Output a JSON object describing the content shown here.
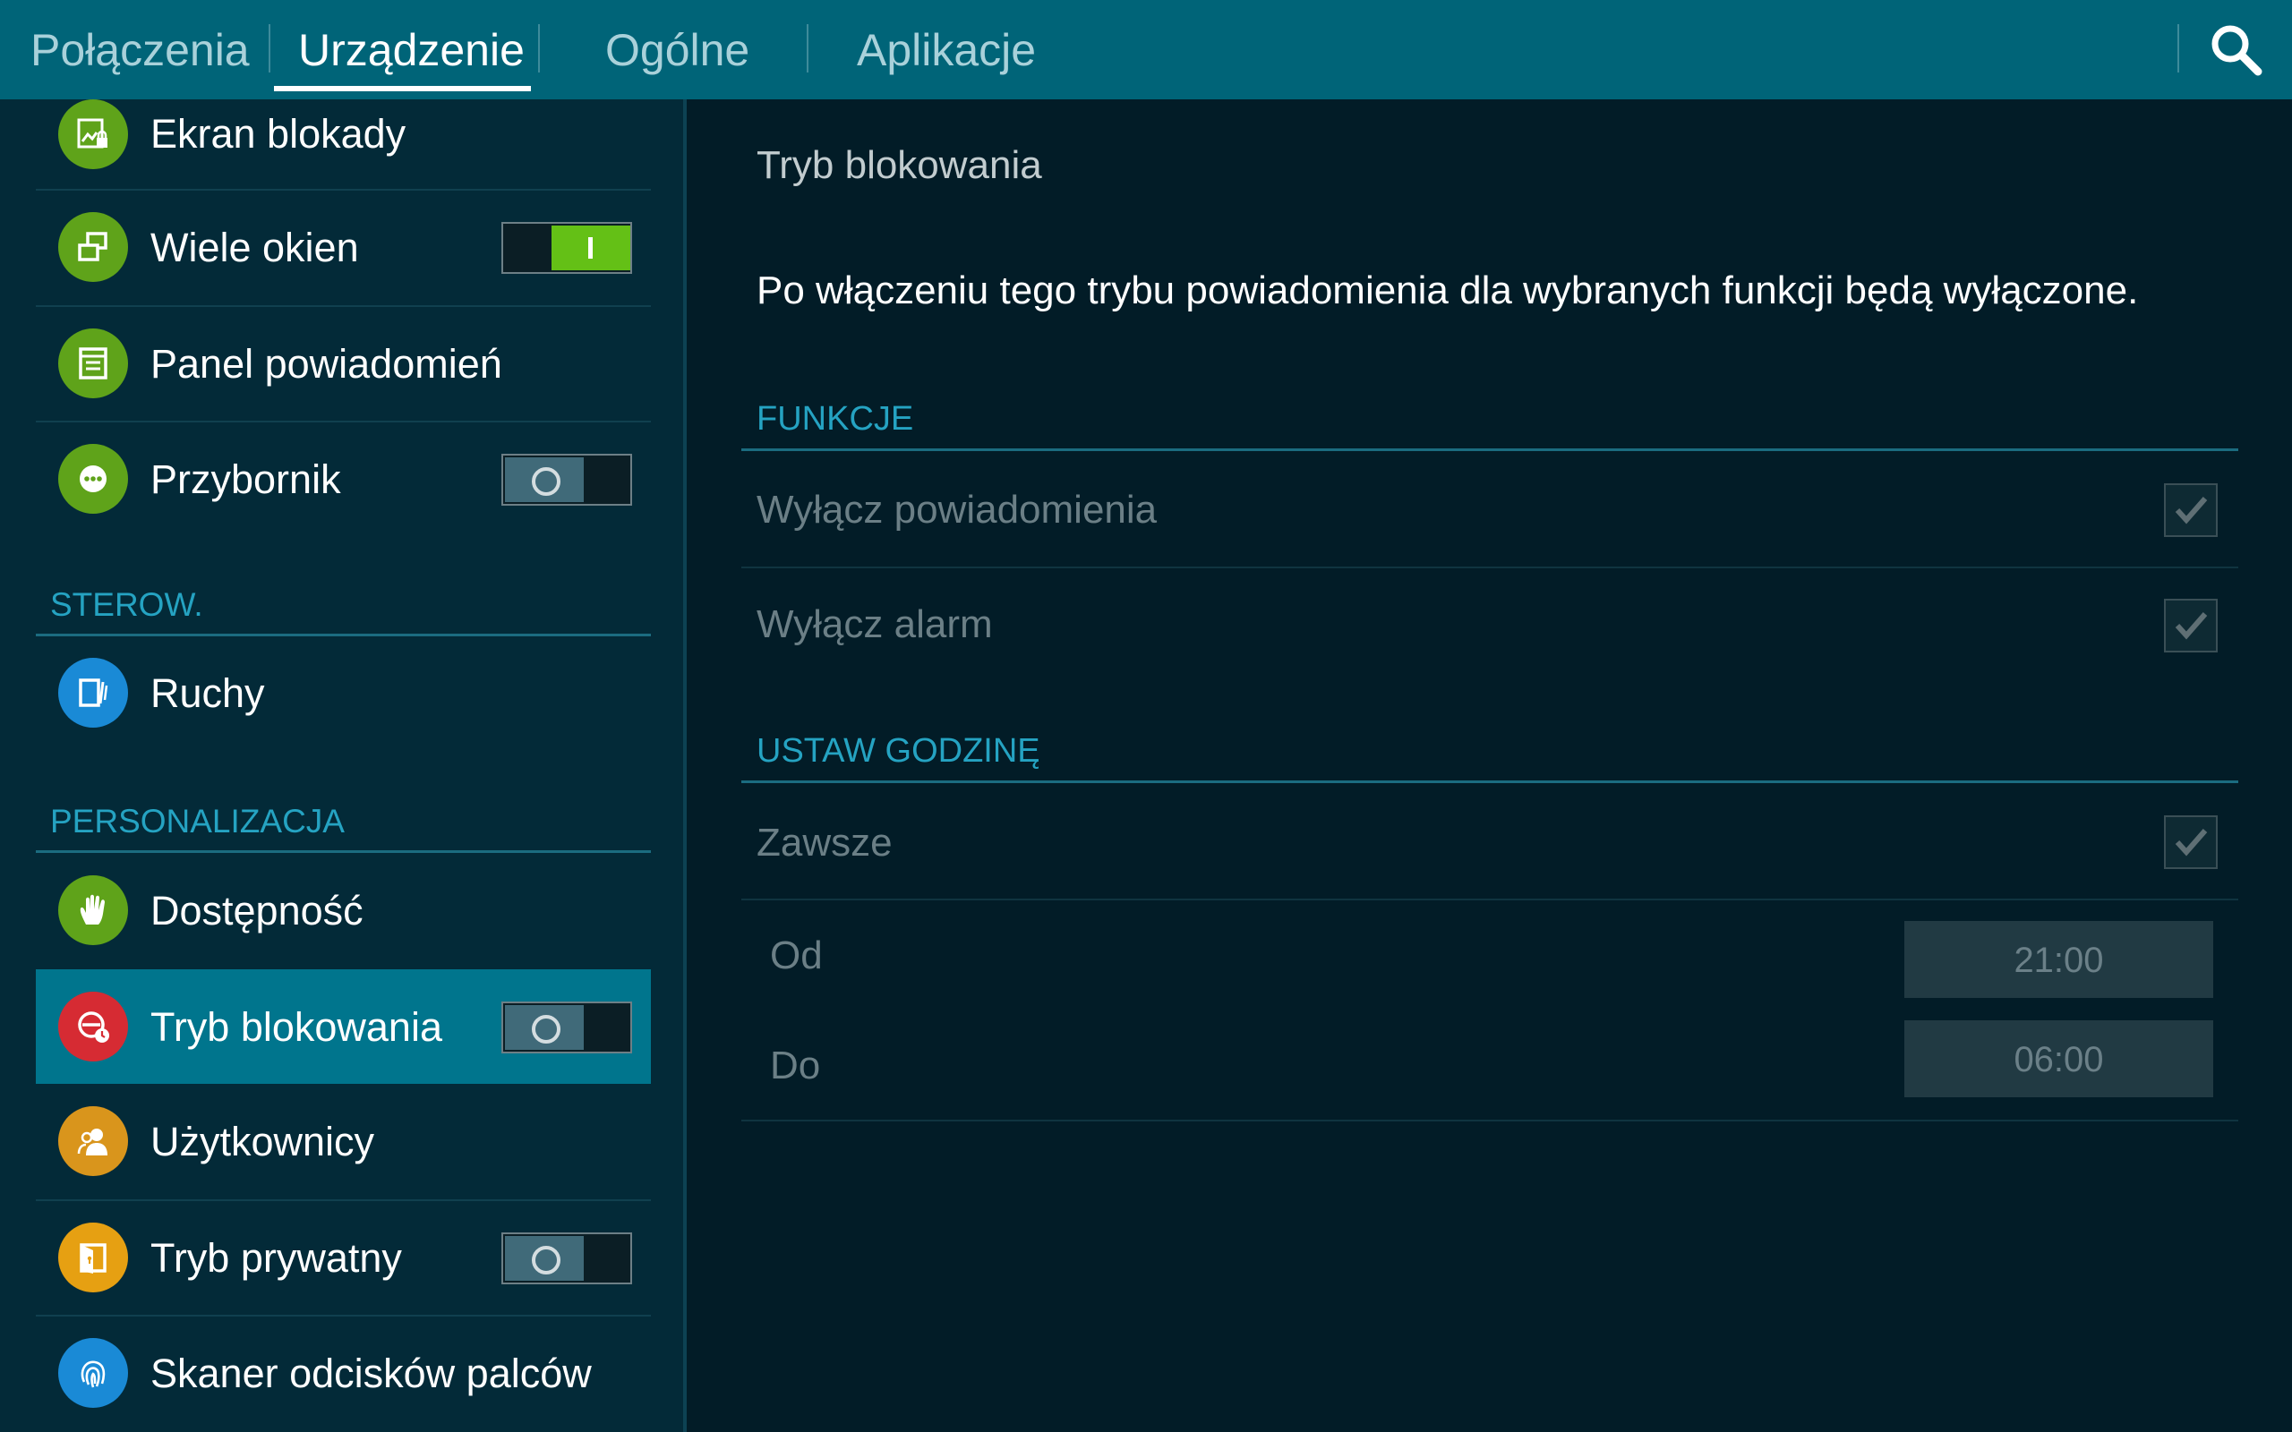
{
  "tabs": [
    {
      "label": "Połączenia"
    },
    {
      "label": "Urządzenie"
    },
    {
      "label": "Ogólne"
    },
    {
      "label": "Aplikacje"
    }
  ],
  "active_tab": "Urządzenie",
  "search_icon": "search-icon",
  "sidebar": {
    "items": [
      {
        "label": "Ekran blokady",
        "icon": "lock-screen-icon",
        "icon_color": "#5fa31a"
      },
      {
        "label": "Wiele okien",
        "icon": "multi-window-icon",
        "icon_color": "#5fa31a",
        "toggle": "on"
      },
      {
        "label": "Panel powiadomień",
        "icon": "notification-panel-icon",
        "icon_color": "#5fa31a"
      },
      {
        "label": "Przybornik",
        "icon": "toolbox-icon",
        "icon_color": "#5fa31a",
        "toggle": "off"
      }
    ],
    "section_control": "STEROW.",
    "control_items": [
      {
        "label": "Ruchy",
        "icon": "motion-icon",
        "icon_color": "#1a8ad6"
      }
    ],
    "section_personalization": "PERSONALIZACJA",
    "personal_items": [
      {
        "label": "Dostępność",
        "icon": "accessibility-hand-icon",
        "icon_color": "#5fa31a"
      },
      {
        "label": "Tryb blokowania",
        "icon": "blocking-mode-icon",
        "icon_color": "#d62b33",
        "toggle": "off",
        "selected": true
      },
      {
        "label": "Użytkownicy",
        "icon": "users-icon",
        "icon_color": "#d9951c"
      },
      {
        "label": "Tryb prywatny",
        "icon": "private-mode-icon",
        "icon_color": "#e6a012",
        "toggle": "off"
      },
      {
        "label": "Skaner odcisków palców",
        "icon": "fingerprint-icon",
        "icon_color": "#1a8ad6"
      }
    ]
  },
  "detail": {
    "title": "Tryb blokowania",
    "description": "Po włączeniu tego trybu powiadomienia dla wybranych funkcji będą wyłączone.",
    "section_functions": "FUNKCJE",
    "functions": [
      {
        "label": "Wyłącz powiadomienia",
        "checked": true
      },
      {
        "label": "Wyłącz alarm",
        "checked": true
      }
    ],
    "section_time": "USTAW GODZINĘ",
    "always": {
      "label": "Zawsze",
      "checked": true
    },
    "from": {
      "label": "Od",
      "value": "21:00"
    },
    "to": {
      "label": "Do",
      "value": "06:00"
    }
  },
  "colors": {
    "topbar": "#006478",
    "accent": "#25a3c2",
    "selected_row": "#00758d",
    "toggle_on": "#64c016"
  }
}
